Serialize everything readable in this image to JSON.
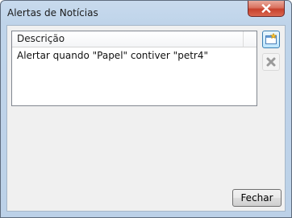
{
  "window": {
    "title": "Alertas de Notícias"
  },
  "list": {
    "columns": [
      "Descrição"
    ],
    "rows": [
      "Alertar quando \"Papel\" contiver \"petr4\""
    ]
  },
  "toolbar": {
    "add_icon": "new-alert-icon",
    "delete_icon": "delete-x-icon"
  },
  "buttons": {
    "close_label": "Fechar"
  },
  "colors": {
    "close_button_red": "#c7412d",
    "frame_blue": "#bfd4ea",
    "selection_blue": "#3c7fb1"
  }
}
